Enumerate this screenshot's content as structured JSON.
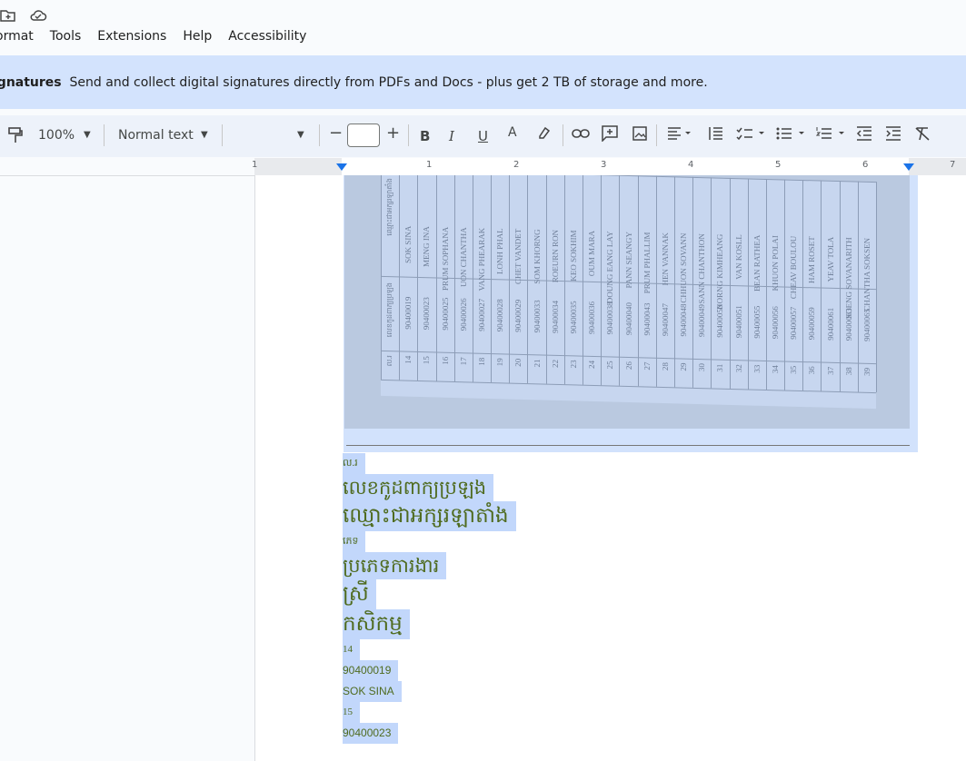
{
  "menu": [
    "ormat",
    "Tools",
    "Extensions",
    "Help",
    "Accessibility"
  ],
  "banner": {
    "title": "ignatures",
    "text": "Send and collect digital signatures directly from PDFs and Docs - plus get 2 TB of storage and more."
  },
  "toolbar": {
    "zoom": "100%",
    "style": "Normal text"
  },
  "ruler": [
    "1",
    "1",
    "2",
    "3",
    "4",
    "5",
    "6",
    "7"
  ],
  "photo": {
    "header": [
      "ល.រ",
      "លេខកូដពាក្យប្រឡង",
      "ឈ្មោះជាអក្សរឡាតាំង"
    ],
    "rows": [
      [
        "14",
        "90400019",
        "SOK SINA"
      ],
      [
        "15",
        "90400023",
        "MENG INA"
      ],
      [
        "16",
        "90400025",
        "PRUM SOPHANA"
      ],
      [
        "17",
        "90400026",
        "UON CHANTHA"
      ],
      [
        "18",
        "90400027",
        "VANG PHEARAK"
      ],
      [
        "19",
        "90400028",
        "LONH PHAL"
      ],
      [
        "20",
        "90400029",
        "CHET VANDET"
      ],
      [
        "21",
        "90400033",
        "SOM KHORNG"
      ],
      [
        "22",
        "90400034",
        "ROEURN RON"
      ],
      [
        "23",
        "90400035",
        "KEO SOKHIM"
      ],
      [
        "24",
        "90400036",
        "OUM MARA"
      ],
      [
        "25",
        "90400038",
        "DOUNG EANG LAY"
      ],
      [
        "26",
        "90400040",
        "PANN SEANGY"
      ],
      [
        "27",
        "90400043",
        "PRUM PHALLIM"
      ],
      [
        "28",
        "90400047",
        "HEN VANNAK"
      ],
      [
        "29",
        "90400048",
        "CHHUON SOVANN"
      ],
      [
        "30",
        "90400049",
        "SANN CHANTHON"
      ],
      [
        "31",
        "90400050",
        "NORNG KIMHEANG"
      ],
      [
        "32",
        "90400051",
        "VAN KOSLL"
      ],
      [
        "33",
        "90400055",
        "BEAN RATHEA"
      ],
      [
        "34",
        "90400056",
        "KHUON POLAI"
      ],
      [
        "35",
        "90400057",
        "CHEAV BOULOU"
      ],
      [
        "36",
        "90400059",
        "HAM ROSET"
      ],
      [
        "37",
        "90400061",
        "YEAV TOLA"
      ],
      [
        "38",
        "90400063",
        "SOENG SOVANARITH"
      ],
      [
        "39",
        "90400065",
        "CHANTHA SOKSEN"
      ]
    ]
  },
  "doc_lines": [
    {
      "text": "ល.រ",
      "size": 11
    },
    {
      "text": "លេខកូដពាក្យប្រឡង",
      "size": 21
    },
    {
      "text": "ឈ្មោះជាអក្សរឡាតាំង",
      "size": 23
    },
    {
      "text": "ភេទ",
      "size": 11
    },
    {
      "text": "ប្រភេទការងារ",
      "size": 21
    },
    {
      "text": "ស្រី",
      "size": 23
    },
    {
      "text": "កសិកម្ម",
      "size": 23
    },
    {
      "text": "14",
      "size": 11
    },
    {
      "text": "90400019",
      "size": 12
    },
    {
      "text": "SOK SINA",
      "size": 12
    },
    {
      "text": "15",
      "size": 11
    },
    {
      "text": "90400023",
      "size": 12
    }
  ]
}
